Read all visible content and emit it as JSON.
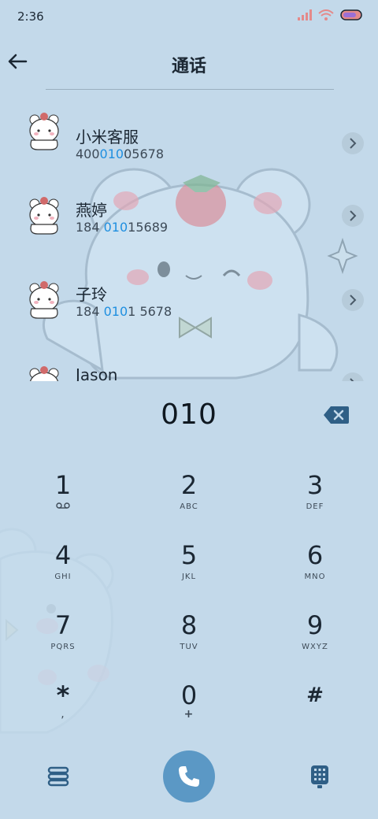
{
  "status_bar": {
    "time": "2:36"
  },
  "header": {
    "title": "通话"
  },
  "contacts": [
    {
      "name": "小米客服",
      "num_pre": "400",
      "num_hl": "010",
      "num_post": "05678"
    },
    {
      "name": "燕婷",
      "num_pre": "184 ",
      "num_hl": "010",
      "num_post": "15689"
    },
    {
      "name": "子玲",
      "num_pre": "184 ",
      "num_hl": "010",
      "num_post": "1 5678"
    },
    {
      "name": "Jason",
      "num_pre": "",
      "num_hl": "",
      "num_post": ""
    }
  ],
  "dialer": {
    "typed": "010"
  },
  "keys": [
    {
      "main": "1",
      "sub": "voicemail-icon"
    },
    {
      "main": "2",
      "sub": "ABC"
    },
    {
      "main": "3",
      "sub": "DEF"
    },
    {
      "main": "4",
      "sub": "GHI"
    },
    {
      "main": "5",
      "sub": "JKL"
    },
    {
      "main": "6",
      "sub": "MNO"
    },
    {
      "main": "7",
      "sub": "PQRS"
    },
    {
      "main": "8",
      "sub": "TUV"
    },
    {
      "main": "9",
      "sub": "WXYZ"
    },
    {
      "main": "*",
      "sub": ","
    },
    {
      "main": "0",
      "sub": "+"
    },
    {
      "main": "#",
      "sub": ""
    }
  ],
  "colors": {
    "background": "#c3d9ea",
    "accent": "#1f8fe0",
    "call_button": "#5b98c5"
  },
  "icons": [
    "back-arrow-icon",
    "chevron-right-icon",
    "backspace-icon",
    "menu-icon",
    "phone-icon",
    "dialpad-icon",
    "signal-icon",
    "wifi-icon",
    "battery-icon"
  ]
}
